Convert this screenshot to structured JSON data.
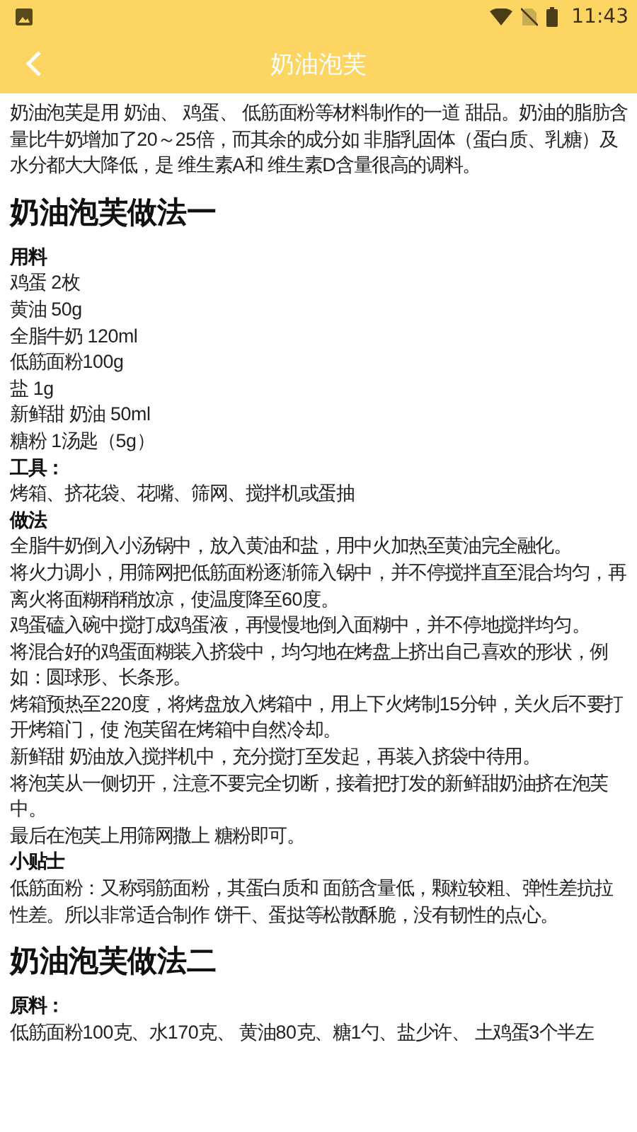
{
  "status_bar": {
    "time": "11:43"
  },
  "toolbar": {
    "title": "奶油泡芙"
  },
  "content": [
    {
      "kind": "paragraph",
      "text": "奶油泡芙是用 奶油、 鸡蛋、 低筋面粉等材料制作的一道 甜品。奶油的脂肪含量比牛奶增加了20～25倍，而其余的成分如 非脂乳固体（蛋白质、乳糖）及水分都大大降低，是 维生素A和 维生素D含量很高的调料。"
    },
    {
      "kind": "heading",
      "text": "奶油泡芙做法一"
    },
    {
      "kind": "label",
      "text": "用料"
    },
    {
      "kind": "line",
      "text": "鸡蛋 2枚"
    },
    {
      "kind": "line",
      "text": "黄油 50g"
    },
    {
      "kind": "line",
      "text": "全脂牛奶 120ml"
    },
    {
      "kind": "line",
      "text": "低筋面粉100g"
    },
    {
      "kind": "line",
      "text": "盐 1g"
    },
    {
      "kind": "line",
      "text": "新鲜甜 奶油 50ml"
    },
    {
      "kind": "line",
      "text": "糖粉 1汤匙（5g）"
    },
    {
      "kind": "label",
      "text": "工具："
    },
    {
      "kind": "line",
      "text": "烤箱、挤花袋、花嘴、筛网、搅拌机或蛋抽"
    },
    {
      "kind": "label",
      "text": "做法"
    },
    {
      "kind": "line",
      "text": "全脂牛奶倒入小汤锅中，放入黄油和盐，用中火加热至黄油完全融化。"
    },
    {
      "kind": "line",
      "text": "将火力调小，用筛网把低筋面粉逐渐筛入锅中，并不停搅拌直至混合均匀，再离火将面糊稍稍放凉，使温度降至60度。"
    },
    {
      "kind": "line",
      "text": "鸡蛋磕入碗中搅打成鸡蛋液，再慢慢地倒入面糊中，并不停地搅拌均匀。"
    },
    {
      "kind": "line",
      "text": "将混合好的鸡蛋面糊装入挤袋中，均匀地在烤盘上挤出自己喜欢的形状，例如：圆球形、长条形。"
    },
    {
      "kind": "line",
      "text": "烤箱预热至220度，将烤盘放入烤箱中，用上下火烤制15分钟，关火后不要打开烤箱门，使 泡芙留在烤箱中自然冷却。"
    },
    {
      "kind": "line",
      "text": "新鲜甜 奶油放入搅拌机中，充分搅打至发起，再装入挤袋中待用。"
    },
    {
      "kind": "line",
      "text": "将泡芙从一侧切开，注意不要完全切断，接着把打发的新鲜甜奶油挤在泡芙中。"
    },
    {
      "kind": "line",
      "text": "最后在泡芙上用筛网撒上 糖粉即可。"
    },
    {
      "kind": "label",
      "text": "小贴士"
    },
    {
      "kind": "line",
      "text": "低筋面粉：又称弱筋面粉，其蛋白质和 面筋含量低，颗粒较粗、弹性差抗拉性差。所以非常适合制作 饼干、蛋挞等松散酥脆，没有韧性的点心。"
    },
    {
      "kind": "heading",
      "text": "奶油泡芙做法二"
    },
    {
      "kind": "label",
      "text": "原料："
    },
    {
      "kind": "line",
      "text": "低筋面粉100克、水170克、 黄油80克、糖1勺、盐少许、 土鸡蛋3个半左"
    }
  ]
}
